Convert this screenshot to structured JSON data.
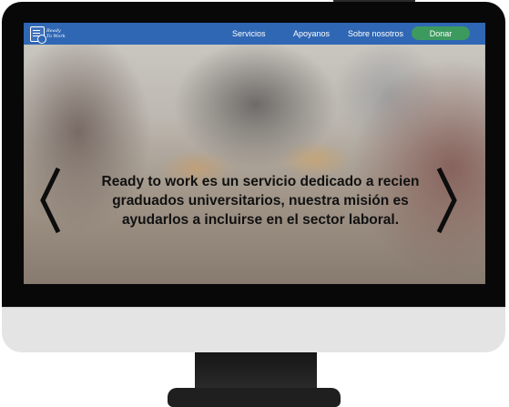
{
  "navbar": {
    "logo_text": "Ready To Work",
    "links": [
      "Servicios",
      "Apoyanos",
      "Sobre nosotros"
    ],
    "donate_label": "Donar",
    "accent_color": "#2f67b4",
    "donate_color": "#3c9a5f"
  },
  "carousel": {
    "text": "Ready to work es un servicio dedicado a recien graduados universitarios, nuestra misión es ayudarlos a incluirse en el sector laboral.",
    "prev_icon": "chevron-left-icon",
    "next_icon": "chevron-right-icon"
  }
}
